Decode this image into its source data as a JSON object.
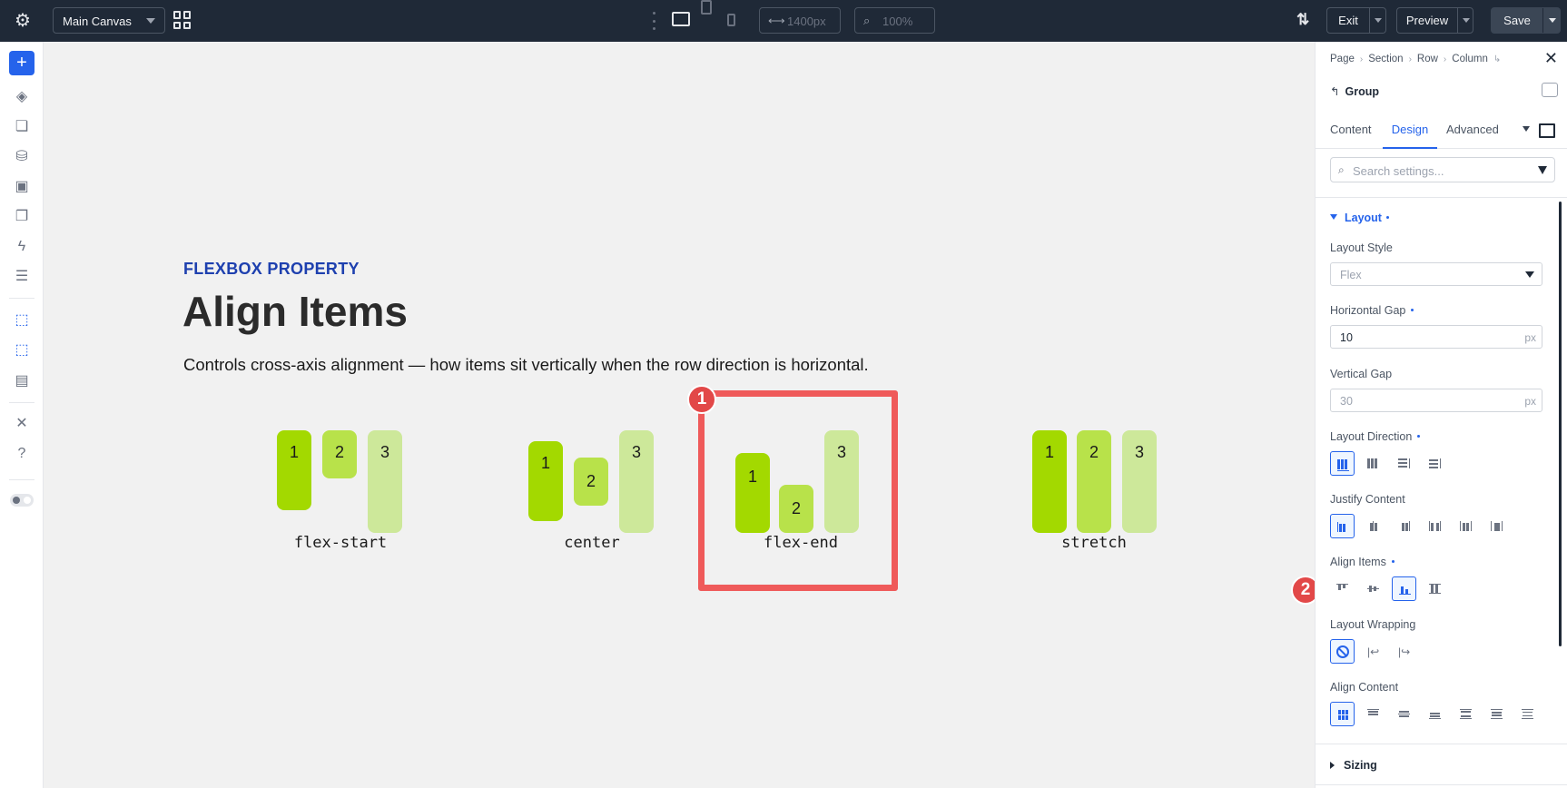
{
  "topbar": {
    "canvas_select": "Main Canvas",
    "width_value": "1400px",
    "zoom_value": "100%",
    "exit_label": "Exit",
    "preview_label": "Preview",
    "save_label": "Save"
  },
  "canvas": {
    "eyebrow": "FLEXBOX PROPERTY",
    "title": "Align Items",
    "description": "Controls cross-axis alignment — how items sit vertically when the row direction is horizontal.",
    "demos": [
      {
        "caption": "flex-start",
        "items": [
          "1",
          "2",
          "3"
        ]
      },
      {
        "caption": "center",
        "items": [
          "1",
          "2",
          "3"
        ]
      },
      {
        "caption": "flex-end",
        "items": [
          "1",
          "2",
          "3"
        ]
      },
      {
        "caption": "stretch",
        "items": [
          "1",
          "2",
          "3"
        ]
      }
    ],
    "markers": [
      "1",
      "2"
    ]
  },
  "colors": {
    "item1": "#a3d900",
    "item2": "#b8e24a",
    "item3": "#cde89a",
    "highlight": "#ef5a5a",
    "accent": "#2563eb",
    "topbar": "#1f2937"
  },
  "panel": {
    "breadcrumb": [
      "Page",
      "Section",
      "Row",
      "Column"
    ],
    "group_title": "Group",
    "tabs": [
      "Content",
      "Design",
      "Advanced"
    ],
    "active_tab": "Design",
    "search_placeholder": "Search settings...",
    "section_layout": "Layout",
    "layout_style_label": "Layout Style",
    "layout_style_value": "Flex",
    "horizontal_gap_label": "Horizontal Gap",
    "horizontal_gap_value": "10",
    "horizontal_gap_unit": "px",
    "vertical_gap_label": "Vertical Gap",
    "vertical_gap_placeholder": "30",
    "vertical_gap_unit": "px",
    "layout_direction_label": "Layout Direction",
    "justify_content_label": "Justify Content",
    "align_items_label": "Align Items",
    "align_items_selected": "flex-end",
    "layout_wrapping_label": "Layout Wrapping",
    "align_content_label": "Align Content",
    "section_sizing": "Sizing"
  }
}
